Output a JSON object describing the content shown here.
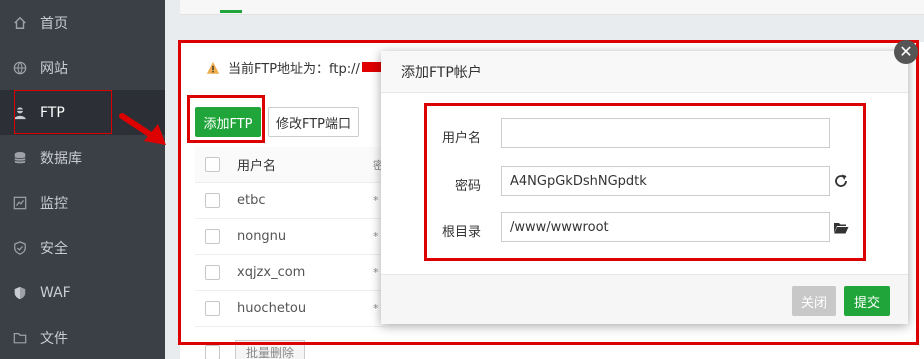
{
  "sidebar": {
    "items": [
      {
        "label": "首页",
        "icon": "home-icon"
      },
      {
        "label": "网站",
        "icon": "globe-icon"
      },
      {
        "label": "FTP",
        "icon": "ftp-user-icon"
      },
      {
        "label": "数据库",
        "icon": "database-icon"
      },
      {
        "label": "监控",
        "icon": "monitor-icon"
      },
      {
        "label": "安全",
        "icon": "shield-icon"
      },
      {
        "label": "WAF",
        "icon": "waf-shield-icon"
      },
      {
        "label": "文件",
        "icon": "folder-icon"
      }
    ],
    "active_index": 2
  },
  "notice": {
    "text": "当前FTP地址为：ftp://"
  },
  "toolbar": {
    "add_label": "添加FTP",
    "port_label": "修改FTP端口"
  },
  "table": {
    "headers": [
      "用户名",
      "密"
    ],
    "rows": [
      "etbc",
      "nongnu",
      "xqjzx_com",
      "huochetou"
    ],
    "masked_cell": "*"
  },
  "batch": {
    "delete_label": "批量删除"
  },
  "modal": {
    "title": "添加FTP帐户",
    "username_label": "用户名",
    "username_value": "",
    "password_label": "密码",
    "password_value": "A4NGpGkDshNGpdtk",
    "root_label": "根目录",
    "root_value": "/www/wwwroot",
    "close_label": "关闭",
    "submit_label": "提交",
    "close_glyph": "✕"
  },
  "colors": {
    "accent": "#20a53a",
    "highlight": "#dd0000",
    "sidebar": "#3b3f46"
  }
}
